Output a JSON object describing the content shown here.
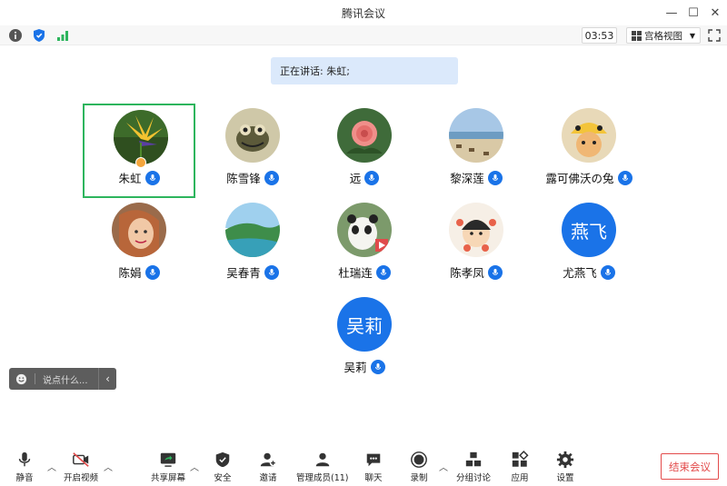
{
  "window": {
    "title": "腾讯会议",
    "minimize": "—",
    "maximize": "☐",
    "close": "✕"
  },
  "toolbar": {
    "timer": "03:53",
    "view_label": "宫格视图"
  },
  "speaking_banner": "正在讲话: 朱虹;",
  "participants": [
    {
      "name": "朱虹",
      "avatar": "bird-of-paradise-flower"
    },
    {
      "name": "陈雪锋",
      "avatar": "frog-cartoon"
    },
    {
      "name": "远",
      "avatar": "rose"
    },
    {
      "name": "黎深莲",
      "avatar": "beach"
    },
    {
      "name": "露可佛沃の兔",
      "avatar": "cat-in-hat"
    },
    {
      "name": "陈娟",
      "avatar": "girl-portrait"
    },
    {
      "name": "吴春青",
      "avatar": "island-lake"
    },
    {
      "name": "杜瑞连",
      "avatar": "panda"
    },
    {
      "name": "陈孝凤",
      "avatar": "cartoon-girl"
    },
    {
      "name": "尤燕飞",
      "avatar_text": "燕飞"
    },
    {
      "name": "吴莉",
      "avatar_text": "吴莉"
    }
  ],
  "chat": {
    "placeholder": "说点什么..."
  },
  "bottom": {
    "mute": "静音",
    "video": "开启视频",
    "share": "共享屏幕",
    "security": "安全",
    "invite": "邀请",
    "members": "管理成员(11)",
    "chat": "聊天",
    "record": "录制",
    "breakout": "分组讨论",
    "apps": "应用",
    "settings": "设置",
    "end": "结束会议"
  },
  "colors": {
    "accent": "#1a73e8",
    "active_border": "#2db55d",
    "end": "#e34b4b"
  }
}
